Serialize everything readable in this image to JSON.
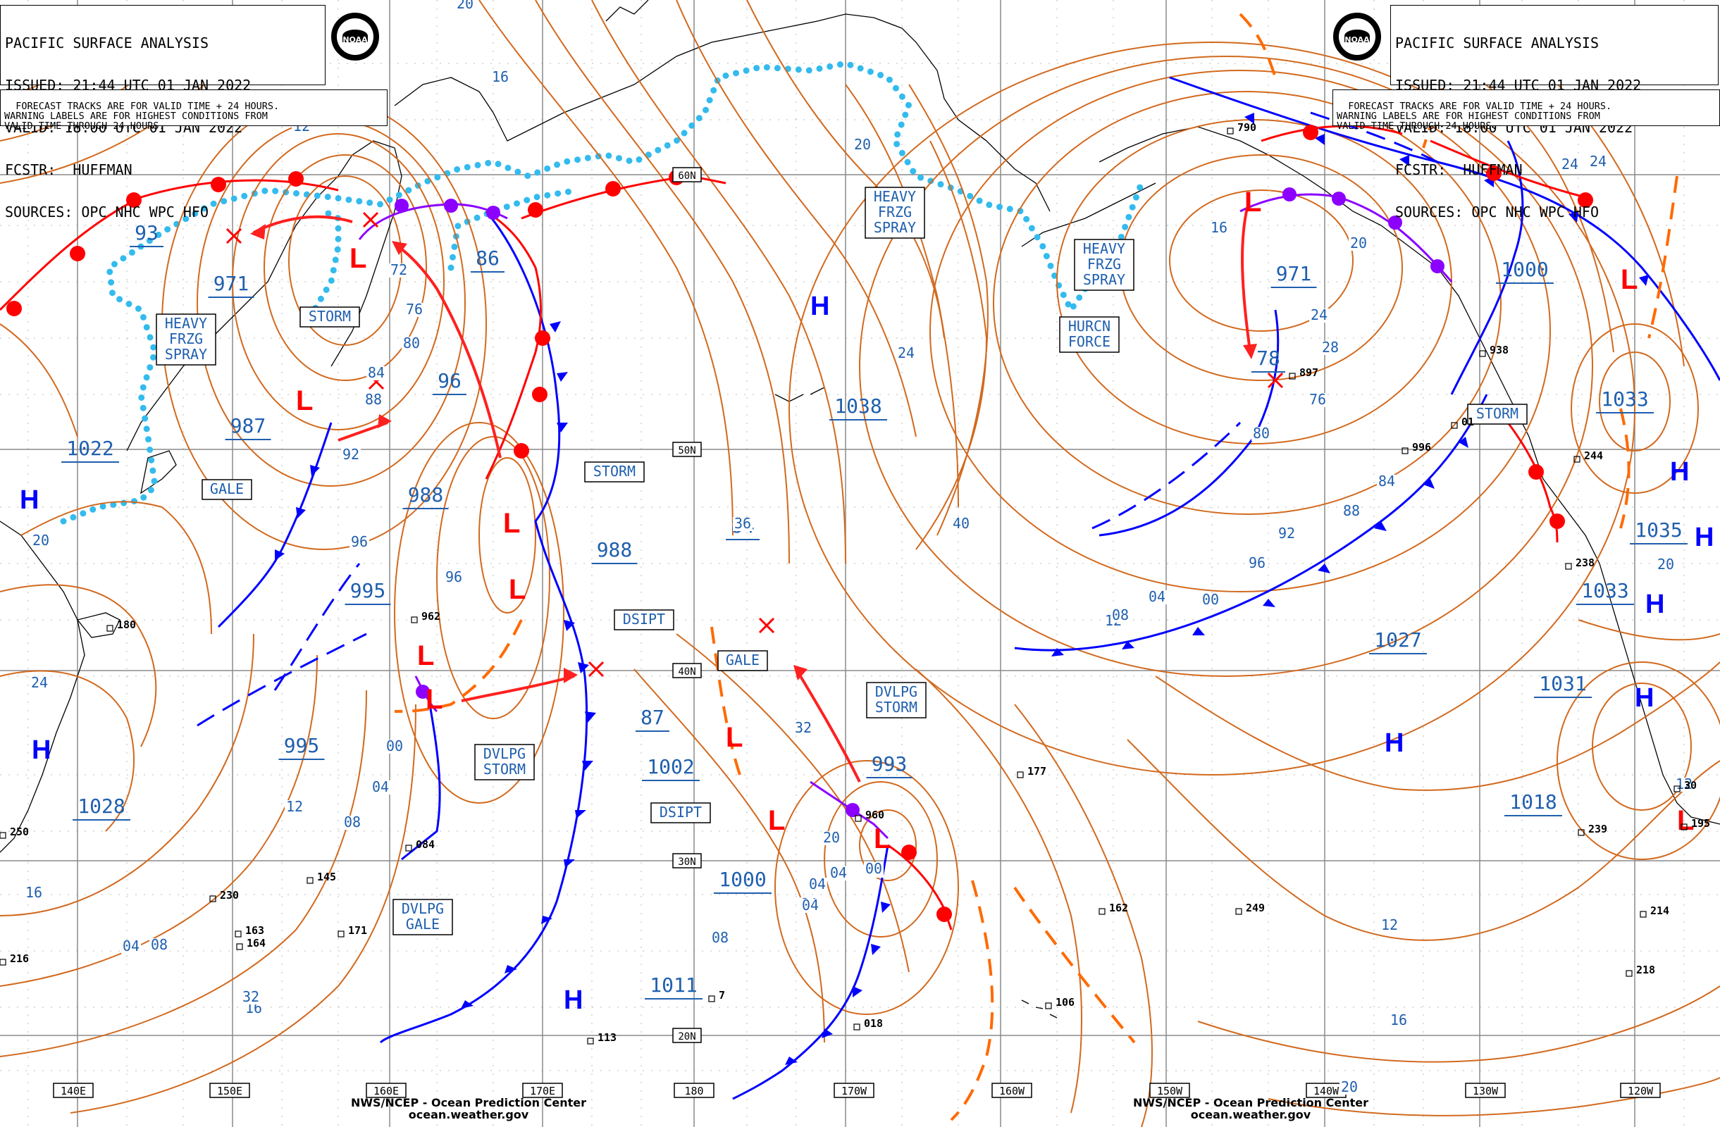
{
  "header": {
    "title": "PACIFIC SURFACE ANALYSIS",
    "issued": "ISSUED: 21:44 UTC 01 JAN 2022",
    "valid": "VALID: 18:00 UTC 01 JAN 2022",
    "forecaster": "FCSTR:  HUFFMAN",
    "sources": "SOURCES: OPC NHC WPC HFO"
  },
  "note": {
    "line1": "FORECAST TRACKS ARE FOR VALID TIME + 24 HOURS.",
    "line2": "WARNING LABELS ARE FOR HIGHEST CONDITIONS FROM",
    "line3": "VALID TIME THROUGH 24 HOURS."
  },
  "logo_text": "NOAA",
  "footer": {
    "line1": "NWS/NCEP - Ocean Prediction Center",
    "line2": "ocean.weather.gov"
  },
  "colors": {
    "isobar": "#d2691e",
    "cold_front": "#0000ff",
    "warm_front": "#ff0000",
    "occluded_front": "#8b00ff",
    "ice_edge": "#33bbee",
    "label_blue": "#1f5fae",
    "grid": "#8a8a8a"
  },
  "longitude_labels": [
    "140E",
    "150E",
    "160E",
    "170E",
    "180",
    "170W",
    "160W",
    "150W",
    "140W",
    "130W",
    "120W"
  ],
  "latitude_labels": [
    "60N",
    "50N",
    "40N",
    "30N",
    "20N"
  ],
  "pressure_centers": [
    {
      "type": "L",
      "value": "971"
    },
    {
      "type": "L",
      "value": "962"
    },
    {
      "type": "L",
      "value": "960"
    },
    {
      "type": "L",
      "value": "971"
    },
    {
      "type": "L",
      "value": "1000"
    },
    {
      "type": "H",
      "value": "1038"
    },
    {
      "type": "H",
      "value": "1022"
    },
    {
      "type": "H",
      "value": "1028"
    },
    {
      "type": "H",
      "value": "1011"
    },
    {
      "type": "H",
      "value": "1033"
    },
    {
      "type": "H",
      "value": "1035"
    },
    {
      "type": "H",
      "value": "1031"
    },
    {
      "type": "H",
      "value": "1027"
    },
    {
      "type": "H",
      "value": "1018"
    }
  ],
  "central_pressure_labels": [
    "93",
    "971",
    "987",
    "1022",
    "86",
    "96",
    "988",
    "995",
    "995",
    "1028",
    "988",
    "84",
    "87",
    "1002",
    "1000",
    "1011",
    "993",
    "1038",
    "78",
    "971",
    "1000",
    "1033",
    "1035",
    "1033",
    "1027",
    "1031",
    "1018"
  ],
  "warning_labels": [
    "STORM",
    "HEAVY\nFRZG\nSPRAY",
    "GALE",
    "STORM",
    "DSIPT",
    "GALE",
    "DVLPG\nSTORM",
    "DSIPT",
    "DVLPG\nSTORM",
    "DVLPG\nGALE",
    "HEAVY\nFRZG\nSPRAY",
    "HEAVY\nFRZG\nSPRAY",
    "HURCN\nFORCE",
    "STORM"
  ],
  "isobar_labels": [
    "20",
    "16",
    "12",
    "72",
    "76",
    "80",
    "84",
    "88",
    "92",
    "96",
    "96",
    "00",
    "04",
    "08",
    "12",
    "16",
    "20",
    "24",
    "20",
    "24",
    "40",
    "36",
    "32",
    "84",
    "04",
    "08",
    "00",
    "04",
    "04",
    "08",
    "12",
    "16",
    "20",
    "24",
    "28",
    "76",
    "80",
    "84",
    "88",
    "92",
    "96",
    "00",
    "04",
    "08",
    "12",
    "16",
    "20",
    "24",
    "24",
    "20",
    "16",
    "04",
    "08",
    "32",
    "20",
    "12"
  ],
  "station_labels": [
    "180",
    "962",
    "084",
    "230",
    "145",
    "163",
    "164",
    "171",
    "216",
    "250",
    "960",
    "018",
    "113",
    "177",
    "162",
    "249",
    "106",
    "790",
    "897",
    "996",
    "244",
    "238",
    "239",
    "214",
    "195",
    "218",
    "938",
    "01",
    "30",
    "7"
  ]
}
